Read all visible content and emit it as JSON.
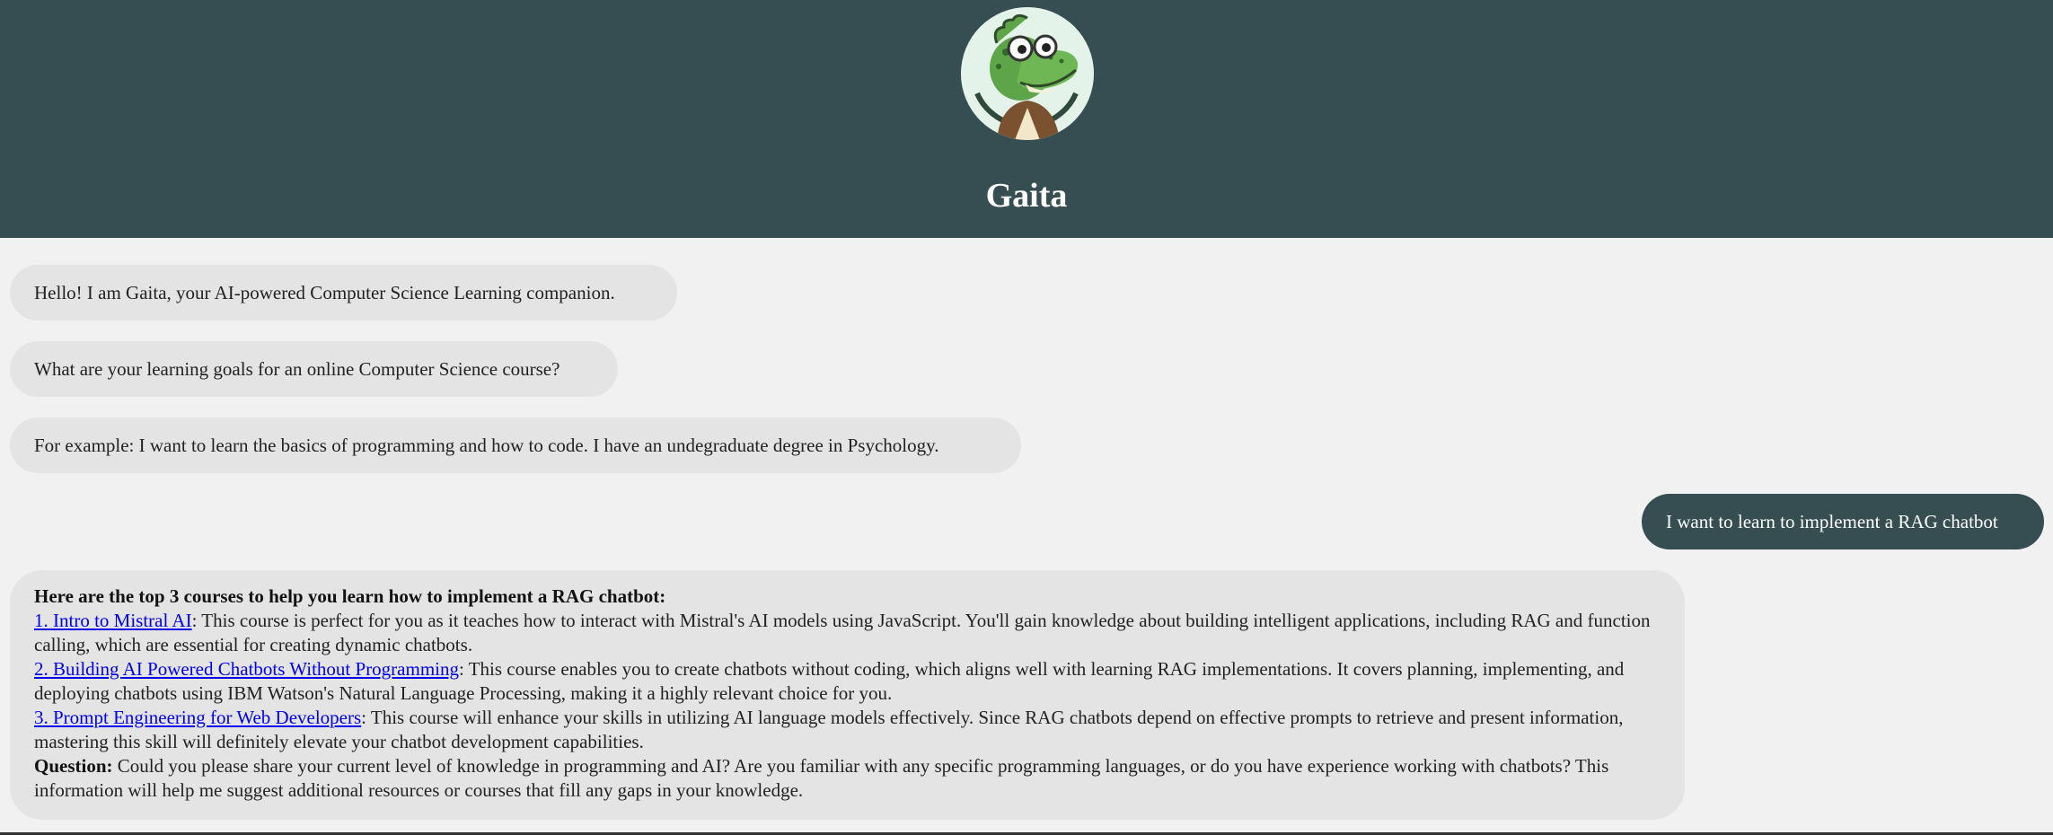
{
  "header": {
    "title": "Gaita",
    "avatar_icon": "crocodile-mascot-icon"
  },
  "messages": [
    {
      "role": "bot",
      "text": "Hello! I am Gaita, your AI-powered Computer Science Learning companion."
    },
    {
      "role": "bot",
      "text": "What are your learning goals for an online Computer Science course?"
    },
    {
      "role": "bot",
      "text": "For example: I want to learn the basics of programming and how to code. I have an undegraduate degree in Psychology."
    },
    {
      "role": "user",
      "text": "I want to learn to implement a RAG chatbot"
    }
  ],
  "recommendation": {
    "heading": "Here are the top 3 courses to help you learn how to implement a RAG chatbot:",
    "courses": [
      {
        "link": "1. Intro to Mistral AI",
        "desc": ": This course is perfect for you as it teaches how to interact with Mistral's AI models using JavaScript. You'll gain knowledge about building intelligent applications, including RAG and function calling, which are essential for creating dynamic chatbots."
      },
      {
        "link": "2. Building AI Powered Chatbots Without Programming",
        "desc": ": This course enables you to create chatbots without coding, which aligns well with learning RAG implementations. It covers planning, implementing, and deploying chatbots using IBM Watson's Natural Language Processing, making it a highly relevant choice for you."
      },
      {
        "link": "3. Prompt Engineering for Web Developers",
        "desc": ": This course will enhance your skills in utilizing AI language models effectively. Since RAG chatbots depend on effective prompts to retrieve and present information, mastering this skill will definitely elevate your chatbot development capabilities."
      }
    ],
    "question_label": "Question:",
    "question_text": " Could you please share your current level of knowledge in programming and AI? Are you familiar with any specific programming languages, or do you have experience working with chatbots? This information will help me suggest additional resources or courses that fill any gaps in your knowledge."
  },
  "colors": {
    "header_bg": "#364e51",
    "bot_bubble": "#e4e4e4",
    "user_bubble": "#364e51",
    "page_bg": "#f1f1f1",
    "link": "#0000ee"
  }
}
